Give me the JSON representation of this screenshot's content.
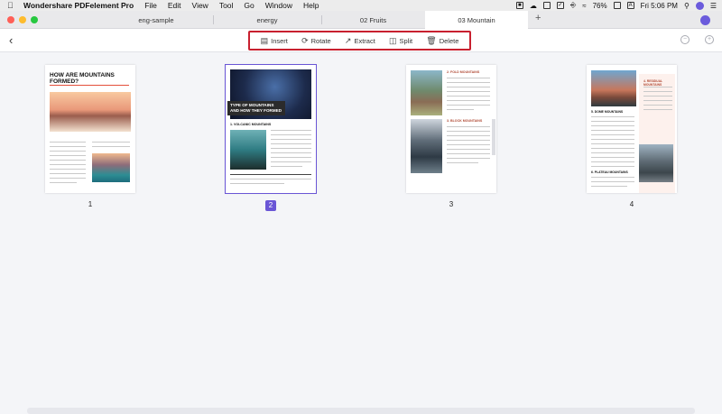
{
  "menubar": {
    "apple_icon": "apple-logo-icon",
    "app_name": "Wondershare PDFelement Pro",
    "menus": [
      "File",
      "Edit",
      "View",
      "Tool",
      "Go",
      "Window",
      "Help"
    ],
    "battery": "76%",
    "input_source": "A",
    "clock": "Fri 5:06 PM"
  },
  "tabs": [
    {
      "label": "eng-sample"
    },
    {
      "label": "energy"
    },
    {
      "label": "02 Fruits"
    },
    {
      "label": "03 Mountain",
      "active": true
    }
  ],
  "new_tab": "+",
  "toolbar": {
    "back_icon": "chevron-left-icon",
    "tools": [
      {
        "label": "Insert",
        "icon": "insert-page-icon"
      },
      {
        "label": "Rotate",
        "icon": "rotate-icon"
      },
      {
        "label": "Extract",
        "icon": "extract-icon"
      },
      {
        "label": "Split",
        "icon": "split-icon"
      },
      {
        "label": "Delete",
        "icon": "trash-icon"
      }
    ],
    "zoom_out": "−",
    "zoom_in": "+",
    "highlight_color": "#c8202f"
  },
  "pages": [
    {
      "number": "1",
      "heading": "HOW ARE MOUNTAINS FORMED?"
    },
    {
      "number": "2",
      "heading": "TYPE OF MOUNTAINS AND HOW THEY FORMED",
      "subheading": "1. VOLCANIC MOUNTAINS",
      "selected": true
    },
    {
      "number": "3",
      "subheading": "2. FOLD MOUNTAINS",
      "subheading2": "3. BLOCK MOUNTAINS"
    },
    {
      "number": "4",
      "subheading": "4. RESIDUAL MOUNTAINS",
      "subheading2": "5. DOME MOUNTAINS",
      "subheading3": "6. PLATEAU MOUNTAINS"
    }
  ],
  "selection_color": "#6a56d6"
}
